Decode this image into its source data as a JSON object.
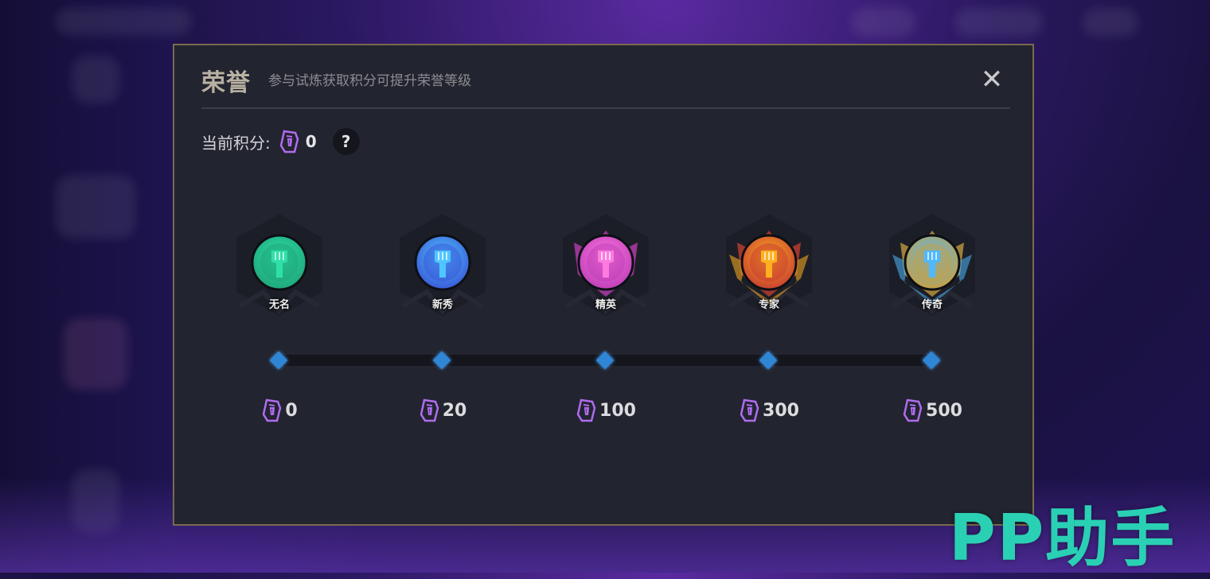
{
  "dialog": {
    "title": "荣誉",
    "subtitle": "参与试炼获取积分可提升荣誉等级",
    "close_label": "✕"
  },
  "score": {
    "label": "当前积分:",
    "value": "0",
    "help_label": "?"
  },
  "tiers": [
    {
      "name": "无名",
      "requirement": "0",
      "color": "#1fa67a",
      "accent": "#2ee0a8"
    },
    {
      "name": "新秀",
      "requirement": "20",
      "color": "#3a5ad8",
      "accent": "#4fc6ff"
    },
    {
      "name": "精英",
      "requirement": "100",
      "color": "#c03fb8",
      "accent": "#ff7ae0"
    },
    {
      "name": "专家",
      "requirement": "300",
      "color": "#c84030",
      "accent": "#ffb020"
    },
    {
      "name": "传奇",
      "requirement": "500",
      "color": "#c8a040",
      "accent": "#4fb8ff"
    }
  ],
  "watermark": "PP助手",
  "colors": {
    "panel_bg": "#22242f",
    "border": "#7a6a4e",
    "point_icon": "#b06cf0",
    "diamond": "#2f86d4"
  },
  "icons": {
    "point": "trophy-point-icon",
    "close": "close-icon",
    "help": "question-icon"
  }
}
